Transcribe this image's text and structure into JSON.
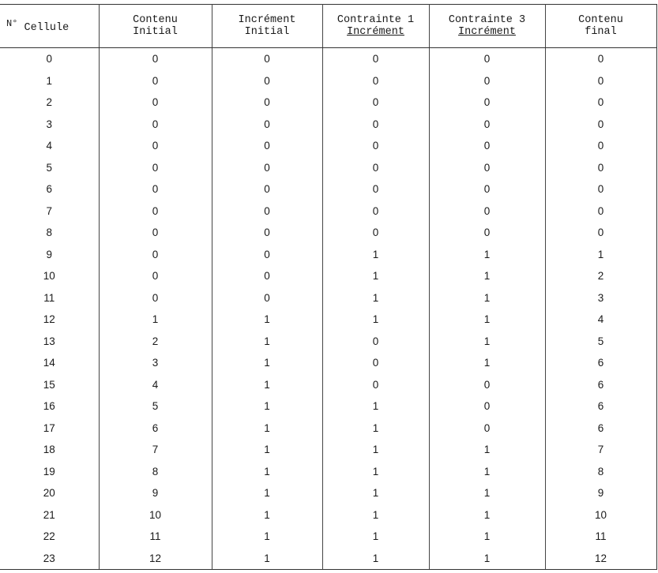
{
  "table": {
    "headers": [
      {
        "line1": "N°",
        "line2": "Cellule",
        "style": "inline-sup"
      },
      {
        "line1": "Contenu",
        "line2": "Initial"
      },
      {
        "line1": "Incrément",
        "line2": "Initial"
      },
      {
        "line1": "Contrainte 1",
        "line2": "Incrément",
        "underline2": true
      },
      {
        "line1": "Contrainte 3",
        "line2": "Incrément",
        "underline2": true
      },
      {
        "line1": "Contenu",
        "line2": "final"
      }
    ],
    "rows": [
      [
        "0",
        "0",
        "0",
        "0",
        "0",
        "0"
      ],
      [
        "1",
        "0",
        "0",
        "0",
        "0",
        "0"
      ],
      [
        "2",
        "0",
        "0",
        "0",
        "0",
        "0"
      ],
      [
        "3",
        "0",
        "0",
        "0",
        "0",
        "0"
      ],
      [
        "4",
        "0",
        "0",
        "0",
        "0",
        "0"
      ],
      [
        "5",
        "0",
        "0",
        "0",
        "0",
        "0"
      ],
      [
        "6",
        "0",
        "0",
        "0",
        "0",
        "0"
      ],
      [
        "7",
        "0",
        "0",
        "0",
        "0",
        "0"
      ],
      [
        "8",
        "0",
        "0",
        "0",
        "0",
        "0"
      ],
      [
        "9",
        "0",
        "0",
        "1",
        "1",
        "1"
      ],
      [
        "10",
        "0",
        "0",
        "1",
        "1",
        "2"
      ],
      [
        "11",
        "0",
        "0",
        "1",
        "1",
        "3"
      ],
      [
        "12",
        "1",
        "1",
        "1",
        "1",
        "4"
      ],
      [
        "13",
        "2",
        "1",
        "0",
        "1",
        "5"
      ],
      [
        "14",
        "3",
        "1",
        "0",
        "1",
        "6"
      ],
      [
        "15",
        "4",
        "1",
        "0",
        "0",
        "6"
      ],
      [
        "16",
        "5",
        "1",
        "1",
        "0",
        "6"
      ],
      [
        "17",
        "6",
        "1",
        "1",
        "0",
        "6"
      ],
      [
        "18",
        "7",
        "1",
        "1",
        "1",
        "7"
      ],
      [
        "19",
        "8",
        "1",
        "1",
        "1",
        "8"
      ],
      [
        "20",
        "9",
        "1",
        "1",
        "1",
        "9"
      ],
      [
        "21",
        "10",
        "1",
        "1",
        "1",
        "10"
      ],
      [
        "22",
        "11",
        "1",
        "1",
        "1",
        "11"
      ],
      [
        "23",
        "12",
        "1",
        "1",
        "1",
        "12"
      ]
    ]
  }
}
